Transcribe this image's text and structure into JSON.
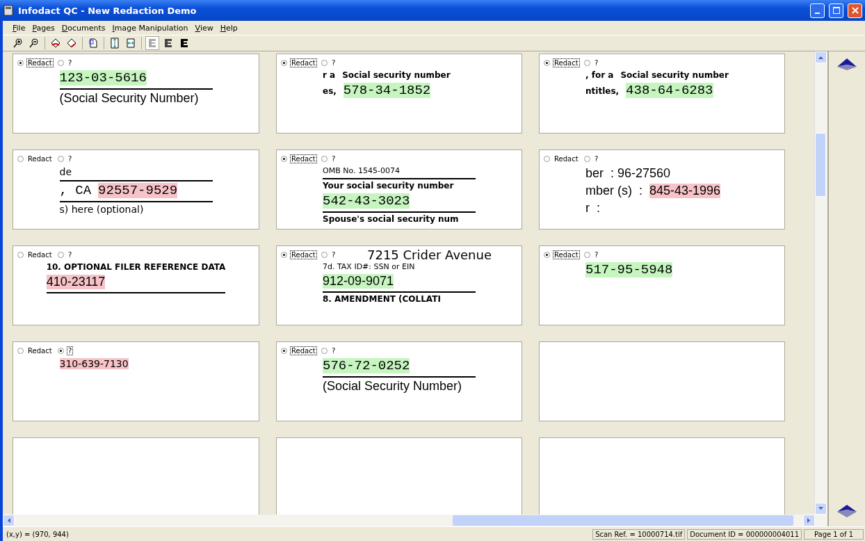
{
  "window": {
    "title": "Infodact QC - New Redaction Demo"
  },
  "menu": [
    {
      "label": "File"
    },
    {
      "label": "Pages"
    },
    {
      "label": "Documents"
    },
    {
      "label": "Image Manipulation"
    },
    {
      "label": "View"
    },
    {
      "label": "Help"
    }
  ],
  "cards": [
    {
      "kind": "snippet",
      "options": [
        {
          "label": "Redact",
          "selected": true
        },
        {
          "label": "?",
          "selected": false
        }
      ],
      "rows": [
        {
          "texts": [
            {
              "text": "123-03-5616",
              "kind": "mono",
              "color": "#c6f5c0"
            }
          ],
          "rule": true
        },
        {
          "texts": [
            {
              "text": "(Social Security Number)",
              "kind": "large"
            }
          ]
        }
      ]
    },
    {
      "kind": "snippet",
      "options": [
        {
          "label": "Redact",
          "selected": true
        },
        {
          "label": "?",
          "selected": false
        }
      ],
      "rows": [
        {
          "texts": [
            {
              "text": "r a",
              "kind": "bold"
            },
            {
              "text": "Social security number",
              "kind": "bold"
            }
          ]
        },
        {
          "texts": [
            {
              "text": "es,",
              "kind": "bold"
            },
            {
              "text": "578-34-1852",
              "kind": "mono",
              "color": "#c6f5c0"
            }
          ]
        }
      ]
    },
    {
      "kind": "snippet",
      "options": [
        {
          "label": "Redact",
          "selected": true
        },
        {
          "label": "?",
          "selected": false
        }
      ],
      "rows": [
        {
          "texts": [
            {
              "text": ", for a",
              "kind": "bold"
            },
            {
              "text": "Social security number",
              "kind": "bold"
            }
          ]
        },
        {
          "texts": [
            {
              "text": "ntitles,",
              "kind": "bold"
            },
            {
              "text": "438-64-6283",
              "kind": "mono",
              "color": "#c6f5c0"
            }
          ]
        }
      ]
    },
    {
      "kind": "snippet",
      "options": [
        {
          "label": "Redact",
          "selected": false
        },
        {
          "label": "?",
          "selected": false
        }
      ],
      "rows": [
        {
          "texts": [
            {
              "text": "de",
              "kind": "plain"
            }
          ],
          "rule": true
        },
        {
          "texts": [
            {
              "text": ", CA",
              "kind": "mono"
            },
            {
              "text": "92557-9529",
              "kind": "mono",
              "color": "#f7c3c8"
            }
          ],
          "rule": true
        },
        {
          "texts": [
            {
              "text": "s) here (optional)",
              "kind": "plain"
            }
          ]
        }
      ]
    },
    {
      "kind": "snippet",
      "options": [
        {
          "label": "Redact",
          "selected": true
        },
        {
          "label": "?",
          "selected": false
        }
      ],
      "rows": [
        {
          "texts": [
            {
              "text": "OMB No. 1545-0074",
              "kind": "small"
            }
          ],
          "rule": true
        },
        {
          "texts": [
            {
              "text": "Your social security number",
              "kind": "bold"
            }
          ]
        },
        {
          "texts": [
            {
              "text": "542-43-3023",
              "kind": "mono",
              "color": "#c6f5c0"
            }
          ],
          "rule": true
        },
        {
          "texts": [
            {
              "text": "Spouse's social security num",
              "kind": "bold"
            }
          ]
        }
      ]
    },
    {
      "kind": "snippet",
      "options": [
        {
          "label": "Redact",
          "selected": false
        },
        {
          "label": "?",
          "selected": false
        }
      ],
      "rows": [
        {
          "texts": [
            {
              "text": "ber",
              "kind": "large"
            },
            {
              "text": ": 96-27560",
              "kind": "large"
            }
          ]
        },
        {
          "texts": [
            {
              "text": "mber (s)",
              "kind": "large"
            },
            {
              "text": ":",
              "kind": "large"
            },
            {
              "text": "845-43-1996",
              "kind": "large",
              "color": "#f7c3c8"
            }
          ]
        },
        {
          "texts": [
            {
              "text": "r",
              "kind": "large"
            },
            {
              "text": ":",
              "kind": "large"
            }
          ]
        }
      ]
    },
    {
      "kind": "snippet",
      "options": [
        {
          "label": "Redact",
          "selected": false
        },
        {
          "label": "?",
          "selected": false
        }
      ],
      "rows": [
        {
          "texts": [
            {
              "text": "10. OPTIONAL FILER REFERENCE DATA",
              "kind": "bold"
            }
          ]
        },
        {
          "texts": [
            {
              "text": "410-23117",
              "kind": "large",
              "color": "#f7c3c8"
            }
          ],
          "rule": true
        }
      ]
    },
    {
      "kind": "snippet",
      "options": [
        {
          "label": "Redact",
          "selected": true
        },
        {
          "label": "?",
          "selected": false
        }
      ],
      "caption": "7215 Crider Avenue",
      "rows": [
        {
          "texts": [
            {
              "text": "7d. TAX ID#: SSN or EIN",
              "kind": "small"
            }
          ]
        },
        {
          "texts": [
            {
              "text": "912-09-9071",
              "kind": "large",
              "color": "#c6f5c0"
            }
          ],
          "rule": true
        },
        {
          "texts": [
            {
              "text": "8. AMENDMENT (COLLATI",
              "kind": "bold"
            }
          ]
        }
      ]
    },
    {
      "kind": "snippet",
      "options": [
        {
          "label": "Redact",
          "selected": true
        },
        {
          "label": "?",
          "selected": false
        }
      ],
      "rows": [
        {
          "texts": [
            {
              "text": "517-95-5948",
              "kind": "mono",
              "color": "#c6f5c0"
            }
          ]
        }
      ]
    },
    {
      "kind": "snippet",
      "options": [
        {
          "label": "Redact",
          "selected": false
        },
        {
          "label": "?",
          "selected": true
        }
      ],
      "rows": [
        {
          "texts": [
            {
              "text": "310-639-7130",
              "kind": "plain",
              "color": "#f7c3c8"
            }
          ]
        }
      ]
    },
    {
      "kind": "snippet",
      "options": [
        {
          "label": "Redact",
          "selected": true
        },
        {
          "label": "?",
          "selected": false
        }
      ],
      "rows": [
        {
          "texts": [
            {
              "text": "576-72-0252",
              "kind": "mono",
              "color": "#c6f5c0"
            }
          ],
          "rule": true
        },
        {
          "texts": [
            {
              "text": "(Social Security Number)",
              "kind": "large"
            }
          ]
        }
      ]
    },
    {
      "kind": "blank"
    },
    {
      "kind": "blank"
    },
    {
      "kind": "blank"
    },
    {
      "kind": "blank"
    }
  ],
  "status_bar": {
    "coordinates": "(x,y) = (970, 944)",
    "scan_ref": "Scan Ref. = 10000714.tif",
    "document_id": "Document ID = 000000004011",
    "page": "Page 1 of  1"
  }
}
